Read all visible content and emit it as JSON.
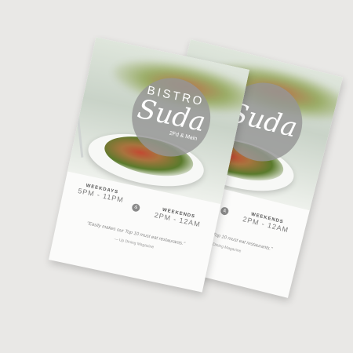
{
  "flyer": {
    "logo_top": "BISTRO",
    "logo_script": "Suda",
    "logo_sub": "2Fd & Main",
    "weekdays_label": "WEEKDAYS",
    "weekdays_time": "5PM - 11PM",
    "amp": "&",
    "weekends_label": "WEEKENDS",
    "weekends_time": "2PM - 12AM",
    "quote": "\"Easily makes our Top 10 must eat restaurants.\"",
    "quote_source": "— Up Dining Magazine"
  },
  "colors": {
    "background": "#e9e8e6",
    "paper": "#fbfbfa",
    "logo_circle": "#969696"
  }
}
